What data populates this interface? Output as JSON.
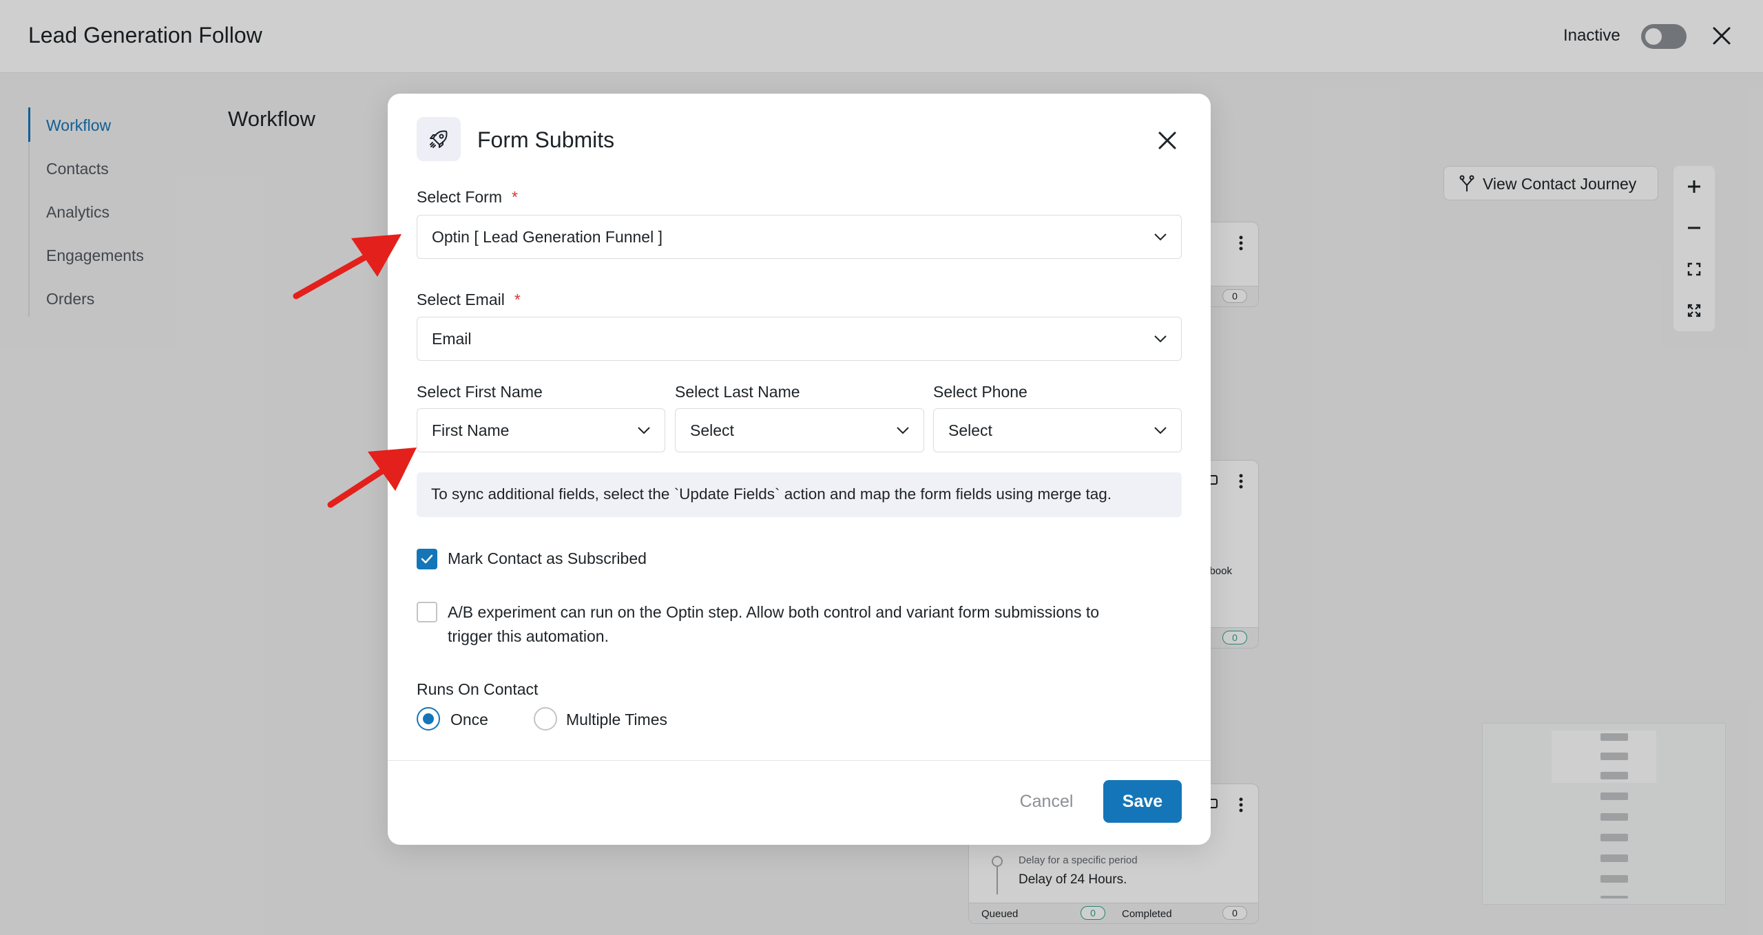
{
  "header": {
    "title": "Lead Generation Follow",
    "status_label": "Inactive"
  },
  "sidebar": {
    "items": [
      {
        "label": "Workflow",
        "active": true
      },
      {
        "label": "Contacts"
      },
      {
        "label": "Analytics"
      },
      {
        "label": "Engagements"
      },
      {
        "label": "Orders"
      }
    ]
  },
  "page": {
    "heading": "Workflow"
  },
  "canvas": {
    "journey_button": "View Contact Journey",
    "node_top_count": "0",
    "node_mid_text": "book",
    "node_mid_count": "0",
    "node_bottom": {
      "subtitle": "Delay for a specific period",
      "title": "Delay of 24 Hours.",
      "queued_label": "Queued",
      "queued_count": "0",
      "completed_label": "Completed",
      "completed_count": "0"
    }
  },
  "modal": {
    "title": "Form Submits",
    "select_form": {
      "label": "Select Form",
      "required": "*",
      "value": "Optin [ Lead Generation Funnel ]"
    },
    "select_email": {
      "label": "Select Email",
      "required": "*",
      "value": "Email"
    },
    "select_first_name": {
      "label": "Select First Name",
      "value": "First Name"
    },
    "select_last_name": {
      "label": "Select Last Name",
      "value": "Select"
    },
    "select_phone": {
      "label": "Select Phone",
      "value": "Select"
    },
    "note": "To sync additional fields, select the `Update Fields` action and map the form fields using merge tag.",
    "subscribe_checkbox": {
      "label": "Mark Contact as Subscribed",
      "checked": true
    },
    "ab_checkbox": {
      "label_line1": "A/B experiment can run on the Optin step. Allow both control and variant form submissions to",
      "label_line2": "trigger this automation.",
      "checked": false
    },
    "runs_on": {
      "label": "Runs On Contact",
      "options": [
        {
          "label": "Once",
          "selected": true
        },
        {
          "label": "Multiple Times",
          "selected": false
        }
      ]
    },
    "cancel_label": "Cancel",
    "save_label": "Save"
  },
  "colors": {
    "accent": "#1476b8",
    "required": "#d63638",
    "annotation_arrow": "#e3201b"
  }
}
